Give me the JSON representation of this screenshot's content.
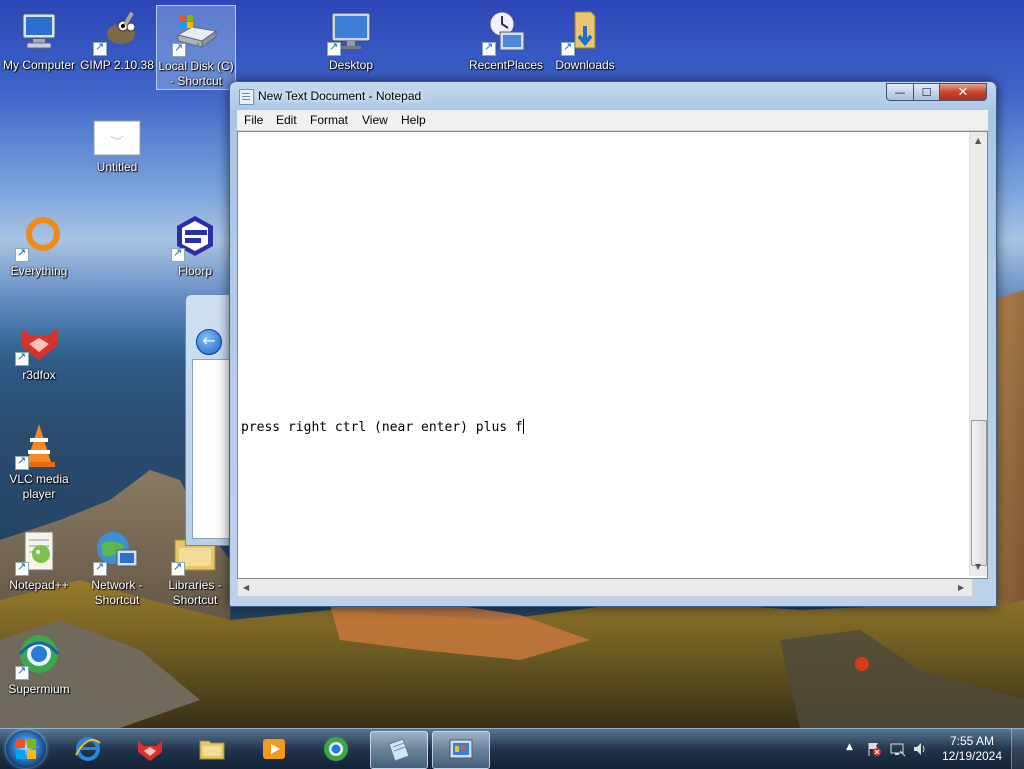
{
  "desktop_icons": [
    {
      "label": "My Computer"
    },
    {
      "label": "GIMP 2.10.38"
    },
    {
      "label": "Local Disk (C) - Shortcut"
    },
    {
      "label": "Desktop"
    },
    {
      "label": "RecentPlaces"
    },
    {
      "label": "Downloads"
    },
    {
      "label": "Untitled"
    },
    {
      "label": "Everything"
    },
    {
      "label": "Floorp"
    },
    {
      "label": "r3dfox"
    },
    {
      "label": "VLC media player"
    },
    {
      "label": "Notepad++"
    },
    {
      "label": "Network - Shortcut"
    },
    {
      "label": "Libraries - Shortcut"
    },
    {
      "label": "Supermium"
    }
  ],
  "notepad": {
    "title": "New Text Document - Notepad",
    "menu": [
      "File",
      "Edit",
      "Format",
      "View",
      "Help"
    ],
    "content": "press right ctrl (near enter) plus f",
    "controls": {
      "minimize": "—",
      "maximize": "☐",
      "close": "✕"
    }
  },
  "taskbar": {
    "items": [
      "internet-explorer",
      "r3dfox",
      "file-explorer",
      "media-player",
      "supermium",
      "notepad",
      "control-panel"
    ],
    "active_item": "notepad",
    "tray_arrow": "▲",
    "clock_time": "7:55 AM",
    "clock_date": "12/19/2024"
  },
  "colors": {
    "taskbar": "#1a3350",
    "window_frame": "#aac6e6",
    "close_button": "#c7442c",
    "selection": "#a0bee6"
  }
}
